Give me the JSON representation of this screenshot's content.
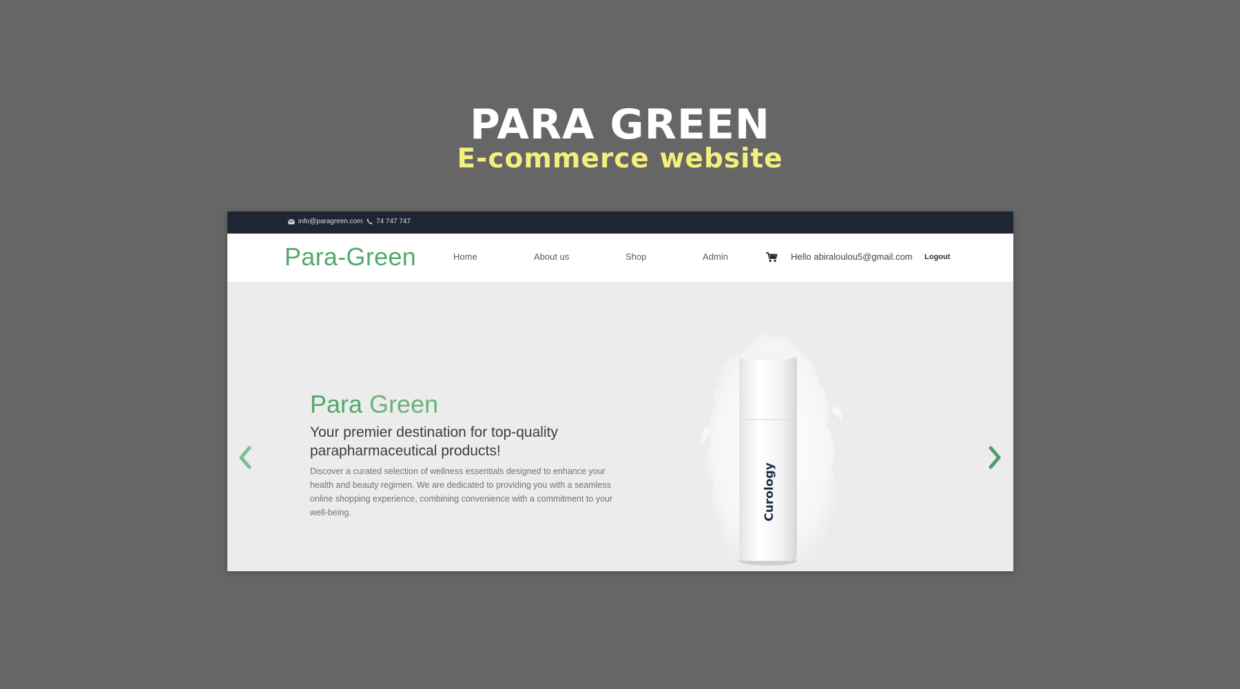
{
  "presentation": {
    "title": "PARA GREEN",
    "subtitle": "E-commerce website"
  },
  "topbar": {
    "email": "info@paragreen.com",
    "phone": "74 747 747"
  },
  "navbar": {
    "brand": "Para-Green",
    "links": [
      "Home",
      "About us",
      "Shop",
      "Admin"
    ],
    "greeting": "Hello abiraloulou5@gmail.com",
    "logout": "Logout"
  },
  "hero": {
    "title_primary": "Para",
    "title_secondary": "Green",
    "heading": "Your premier destination for top-quality parapharmaceutical products!",
    "text": "Discover a curated selection of wellness essentials designed to enhance your health and beauty regimen. We are dedicated to providing you with a seamless online shopping experience, combining convenience with a commitment to your well-being.",
    "product_label": "Curology"
  },
  "colors": {
    "brand_green": "#52a86b",
    "topbar_bg": "#1e2633",
    "page_bg": "#666666",
    "subtitle_yellow": "#f3ef7e"
  },
  "icons": {
    "email": "envelope-icon",
    "phone": "phone-icon",
    "cart": "cart-icon",
    "prev": "chevron-left-icon",
    "next": "chevron-right-icon"
  }
}
